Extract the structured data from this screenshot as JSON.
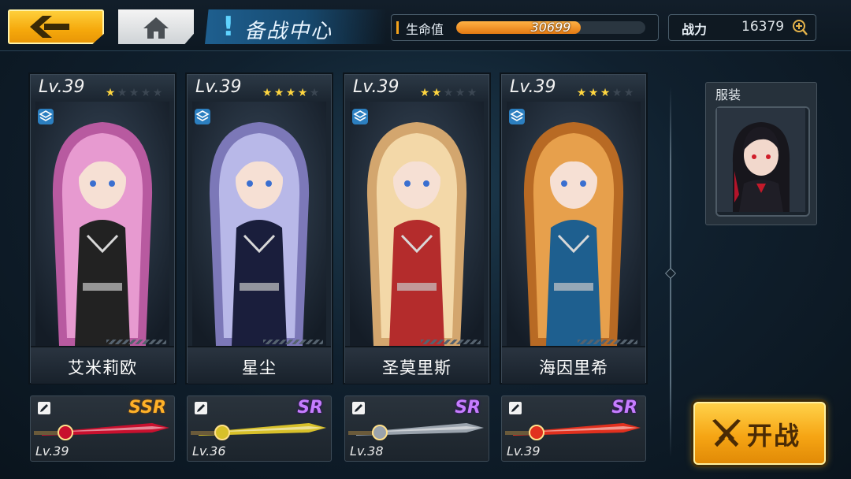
{
  "header": {
    "title": "备战中心",
    "hp": {
      "label": "生命值",
      "value": "30699",
      "fill_percent": 66
    },
    "power": {
      "label": "战力",
      "value": "16379"
    }
  },
  "characters": [
    {
      "level": "Lv.39",
      "stars": 1,
      "max_stars": 5,
      "name": "艾米莉欧",
      "hair": "#e79ad0",
      "hair2": "#b85aa0",
      "outfit": "#222"
    },
    {
      "level": "Lv.39",
      "stars": 4,
      "max_stars": 4,
      "name": "星尘",
      "hair": "#b8b8e8",
      "hair2": "#7c78b8",
      "outfit": "#1a1e3c"
    },
    {
      "level": "Lv.39",
      "stars": 2,
      "max_stars": 5,
      "name": "圣莫里斯",
      "hair": "#f3d8a8",
      "hair2": "#d3a66e",
      "outfit": "#b42c2c"
    },
    {
      "level": "Lv.39",
      "stars": 3,
      "max_stars": 5,
      "name": "海因里希",
      "hair": "#e7a04c",
      "hair2": "#b86a24",
      "outfit": "#1e5f8f"
    }
  ],
  "weapons": [
    {
      "level": "Lv.39",
      "rarity": "SSR",
      "color": "#c8102e"
    },
    {
      "level": "Lv.36",
      "rarity": "SR",
      "color": "#d7c02a"
    },
    {
      "level": "Lv.38",
      "rarity": "SR",
      "color": "#9aa3ad"
    },
    {
      "level": "Lv.39",
      "rarity": "SR",
      "color": "#e0301e"
    }
  ],
  "outfit": {
    "label": "服装"
  },
  "fight_button": {
    "label": "开战"
  },
  "colors": {
    "accent_gold": "#f6a514",
    "hp_fill": "#e47a12",
    "ssr": "#ffb128",
    "sr": "#c67dff"
  }
}
